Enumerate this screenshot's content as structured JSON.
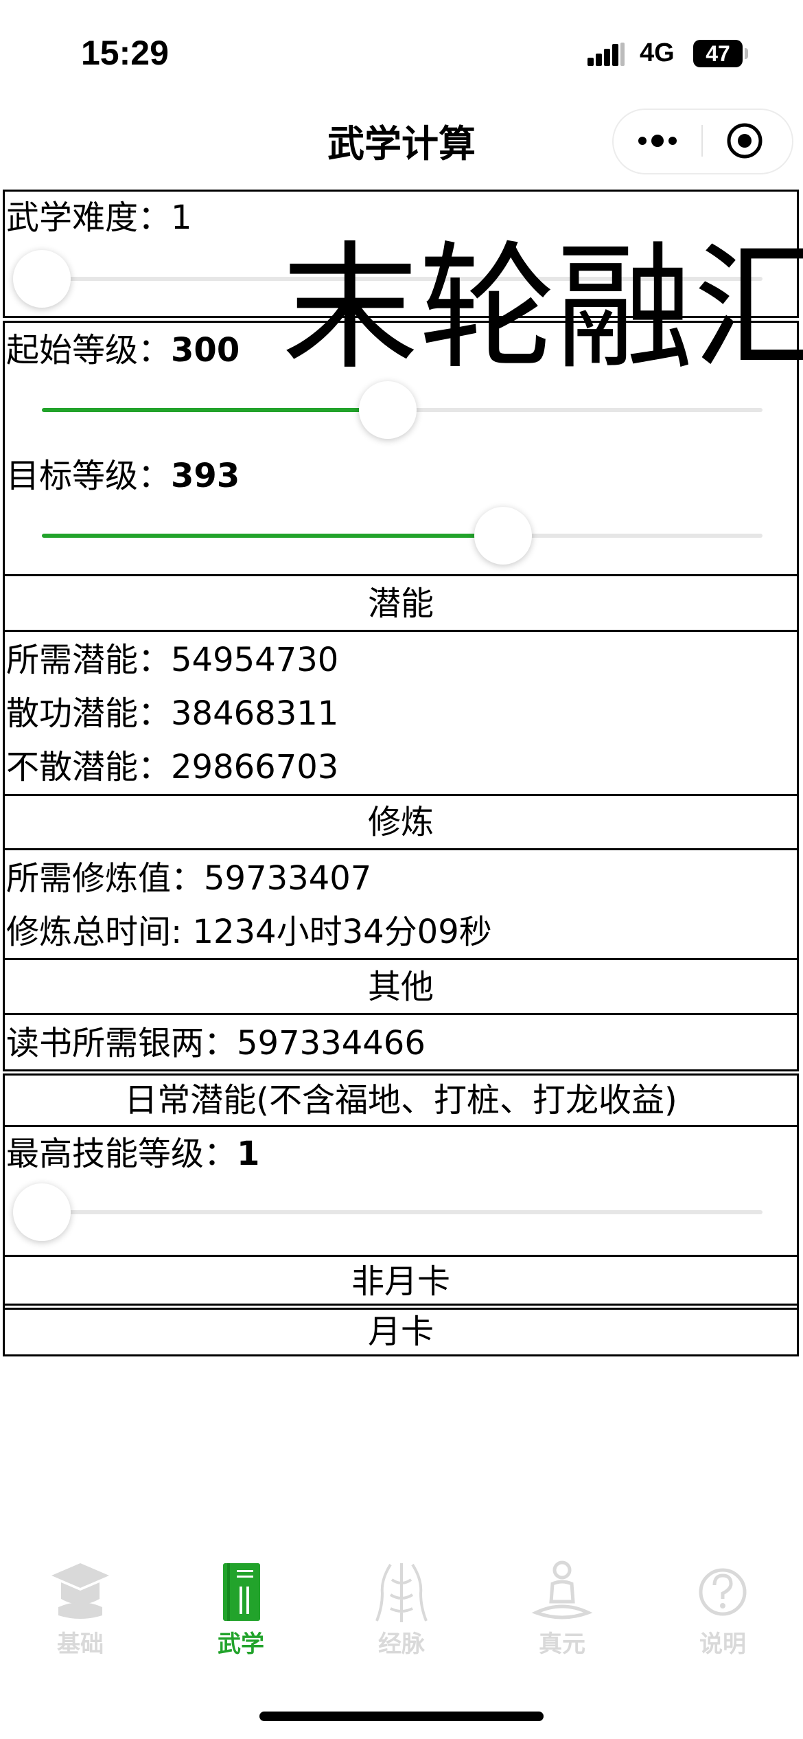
{
  "status_bar": {
    "time": "15:29",
    "network": "4G",
    "battery": "47"
  },
  "nav": {
    "title": "武学计算",
    "more_icon": "more-dots-icon",
    "close_icon": "target-circle-icon"
  },
  "difficulty": {
    "label": "武学难度：",
    "value": "1",
    "slider_fraction": 0.0
  },
  "watermark": "末轮融汇",
  "levels": {
    "start_label": "起始等级：",
    "start_value": "300",
    "start_fraction": 0.48,
    "target_label": "目标等级：",
    "target_value": "393",
    "target_fraction": 0.64
  },
  "potential": {
    "header": "潜能",
    "rows": [
      {
        "label": "所需潜能：",
        "value": "54954730"
      },
      {
        "label": "散功潜能：",
        "value": "38468311"
      },
      {
        "label": "不散潜能：",
        "value": "29866703"
      }
    ]
  },
  "cultivation": {
    "header": "修炼",
    "rows": [
      {
        "label": "所需修炼值：",
        "value": "59733407"
      },
      {
        "label": "修炼总时间: ",
        "value": "1234小时34分09秒"
      }
    ]
  },
  "other": {
    "header": "其他",
    "rows": [
      {
        "label": "读书所需银两：",
        "value": "597334466"
      }
    ]
  },
  "daily": {
    "header": "日常潜能(不含福地、打桩、打龙收益)",
    "max_level_label": "最高技能等级：",
    "max_level_value": "1",
    "slider_fraction": 0.0,
    "non_monthly": "非月卡",
    "monthly": "月卡"
  },
  "colors": {
    "accent": "#22a32b",
    "inactive": "#d9d9d9"
  },
  "tabs": [
    {
      "label": "基础",
      "icon": "graduation-cap-icon",
      "active": false
    },
    {
      "label": "武学",
      "icon": "book-icon",
      "active": true
    },
    {
      "label": "经脉",
      "icon": "meridian-body-icon",
      "active": false
    },
    {
      "label": "真元",
      "icon": "meditation-icon",
      "active": false
    },
    {
      "label": "说明",
      "icon": "question-icon",
      "active": false
    }
  ]
}
